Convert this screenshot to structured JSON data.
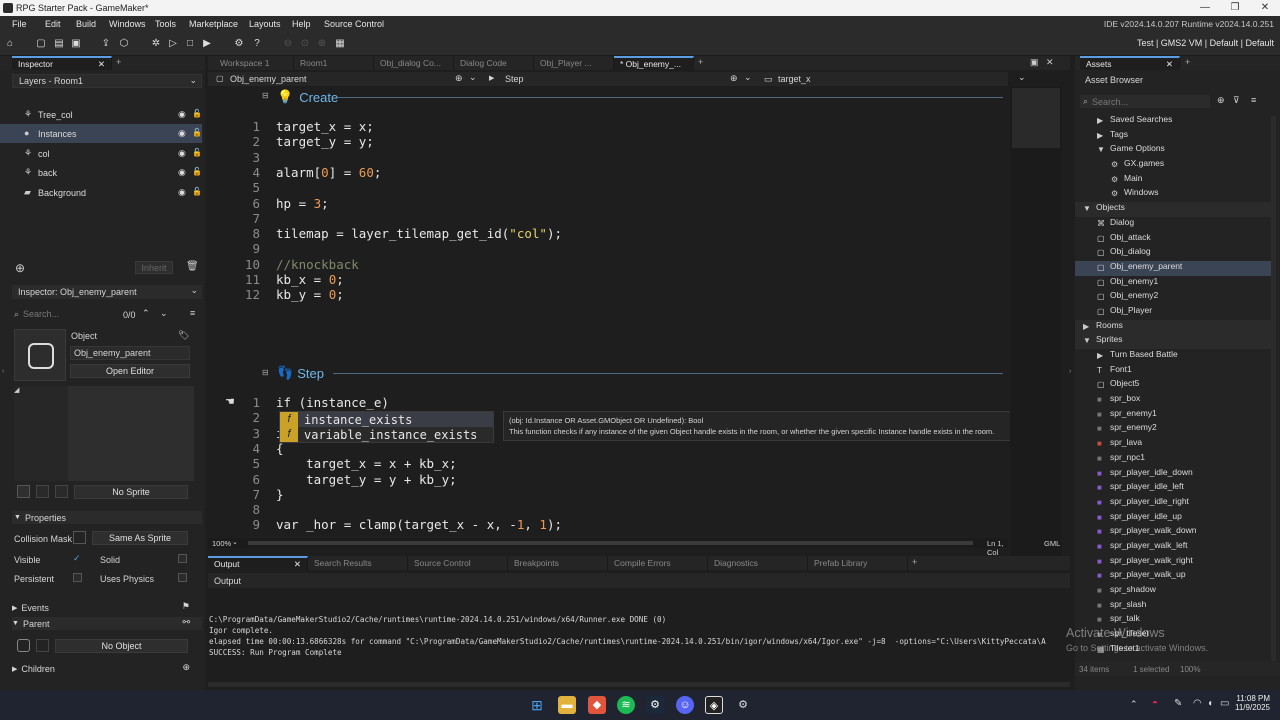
{
  "window": {
    "title": "RPG Starter Pack - GameMaker*"
  },
  "menu": [
    "File",
    "Edit",
    "Build",
    "Windows",
    "Tools",
    "Marketplace",
    "Layouts",
    "Help",
    "Source Control"
  ],
  "ide_version": "IDE v2024.14.0.207  Runtime v2024.14.0.251",
  "target_bar": "Test | GMS2 VM | Default | Default",
  "left": {
    "inspector_tab": "Inspector",
    "layers_title": "Layers - Room1",
    "layers": [
      {
        "name": "Tree_col",
        "icon": "tile-icon"
      },
      {
        "name": "Instances",
        "icon": "instance-icon"
      },
      {
        "name": "col",
        "icon": "tile-icon"
      },
      {
        "name": "back",
        "icon": "tile-icon"
      },
      {
        "name": "Background",
        "icon": "background-icon"
      }
    ],
    "inherit_label": "Inherit",
    "inspector_obj_title": "Inspector: Obj_enemy_parent",
    "search_placeholder": "Search...",
    "search_count": "0/0",
    "object_label": "Object",
    "object_name": "Obj_enemy_parent",
    "open_editor": "Open Editor",
    "no_sprite": "No Sprite",
    "properties_label": "Properties",
    "collision_mask_label": "Collision Mask",
    "same_as_sprite": "Same As Sprite",
    "visible_label": "Visible",
    "solid_label": "Solid",
    "persistent_label": "Persistent",
    "uses_physics_label": "Uses Physics",
    "events_label": "Events",
    "parent_label": "Parent",
    "no_object": "No Object",
    "children_label": "Children"
  },
  "editor": {
    "tabs": [
      "Workspace 1",
      "Room1",
      "Obj_dialog Co...",
      "Dialog Code",
      "Obj_Player ...",
      "* Obj_enemy_..."
    ],
    "breadcrumb_object": "Obj_enemy_parent",
    "breadcrumb_event": "Step",
    "breadcrumb_var": "target_x",
    "create_header": "Create",
    "step_header": "Step",
    "zoom": "100%",
    "cursor_pos": "Ln 1, Col 15",
    "lang": "GML",
    "create_lines": [
      {
        "n": "1",
        "t": "target_x = x;"
      },
      {
        "n": "2",
        "t": "target_y = y;"
      },
      {
        "n": "3",
        "t": ""
      },
      {
        "n": "4",
        "t": "alarm[0] = 60;"
      },
      {
        "n": "5",
        "t": ""
      },
      {
        "n": "6",
        "t": "hp = 3;"
      },
      {
        "n": "7",
        "t": ""
      },
      {
        "n": "8",
        "t": "tilemap = layer_tilemap_get_id(\"col\");"
      },
      {
        "n": "9",
        "t": ""
      },
      {
        "n": "10",
        "t": "//knockback"
      },
      {
        "n": "11",
        "t": "kb_x = 0;"
      },
      {
        "n": "12",
        "t": "kb_y = 0;"
      }
    ],
    "step_lines": [
      {
        "n": "1",
        "t": "if (instance_e)"
      },
      {
        "n": "2",
        "t": ""
      },
      {
        "n": "3",
        "t": "i"
      },
      {
        "n": "4",
        "t": "{"
      },
      {
        "n": "5",
        "t": "    target_x = x + kb_x;"
      },
      {
        "n": "6",
        "t": "    target_y = y + kb_y;"
      },
      {
        "n": "7",
        "t": "}"
      },
      {
        "n": "8",
        "t": ""
      },
      {
        "n": "9",
        "t": "var _hor = clamp(target_x - x, -1, 1);"
      }
    ],
    "autocomplete": [
      "instance_exists",
      "variable_instance_exists"
    ],
    "tooltip_sig": "(obj: Id.Instance OR Asset.GMObject OR Undefined): Bool",
    "tooltip_desc": "This function checks if any instance of the given Object handle exists in the room, or whether the given specific Instance handle exists in the room."
  },
  "output": {
    "tabs": [
      "Output",
      "Search Results",
      "Source Control",
      "Breakpoints",
      "Compile Errors",
      "Diagnostics",
      "Prefab Library"
    ],
    "header": "Output",
    "lines": [
      "C:\\ProgramData/GameMakerStudio2/Cache/runtimes\\runtime-2024.14.0.251/windows/x64/Runner.exe DONE (0)",
      "Igor complete.",
      "elapsed time 00:00:13.6866328s for command \"C:\\ProgramData/GameMakerStudio2/Cache/runtimes\\runtime-2024.14.0.251/bin/igor/windows/x64/Igor.exe\" -j=8  -options=\"C:\\Users\\KittyPeccata\\A",
      "SUCCESS: Run Program Complete"
    ]
  },
  "assets": {
    "tab": "Assets",
    "title": "Asset Browser",
    "search_placeholder": "Search...",
    "items": [
      {
        "label": "Saved Searches",
        "indent": 1,
        "kind": "folder-closed"
      },
      {
        "label": "Tags",
        "indent": 1,
        "kind": "folder-closed"
      },
      {
        "label": "Game Options",
        "indent": 1,
        "kind": "folder-open"
      },
      {
        "label": "GX.games",
        "indent": 2,
        "kind": "gear"
      },
      {
        "label": "Main",
        "indent": 2,
        "kind": "gear"
      },
      {
        "label": "Windows",
        "indent": 2,
        "kind": "gear"
      },
      {
        "label": "Objects",
        "indent": 0,
        "kind": "group"
      },
      {
        "label": "Dialog",
        "indent": 1,
        "kind": "script"
      },
      {
        "label": "Obj_attack",
        "indent": 1,
        "kind": "object"
      },
      {
        "label": "Obj_dialog",
        "indent": 1,
        "kind": "object"
      },
      {
        "label": "Obj_enemy_parent",
        "indent": 1,
        "kind": "object",
        "selected": true
      },
      {
        "label": "Obj_enemy1",
        "indent": 1,
        "kind": "object"
      },
      {
        "label": "Obj_enemy2",
        "indent": 1,
        "kind": "object"
      },
      {
        "label": "Obj_Player",
        "indent": 1,
        "kind": "object"
      },
      {
        "label": "Rooms",
        "indent": 0,
        "kind": "group-closed"
      },
      {
        "label": "Sprites",
        "indent": 0,
        "kind": "group"
      },
      {
        "label": "Turn Based Battle",
        "indent": 1,
        "kind": "folder-closed"
      },
      {
        "label": "Font1",
        "indent": 1,
        "kind": "font"
      },
      {
        "label": "Object5",
        "indent": 1,
        "kind": "object"
      },
      {
        "label": "spr_box",
        "indent": 1,
        "kind": "sprite"
      },
      {
        "label": "spr_enemy1",
        "indent": 1,
        "kind": "sprite"
      },
      {
        "label": "spr_enemy2",
        "indent": 1,
        "kind": "sprite"
      },
      {
        "label": "spr_lava",
        "indent": 1,
        "kind": "sprite-red"
      },
      {
        "label": "spr_npc1",
        "indent": 1,
        "kind": "sprite"
      },
      {
        "label": "spr_player_idle_down",
        "indent": 1,
        "kind": "sprite-purple"
      },
      {
        "label": "spr_player_idle_left",
        "indent": 1,
        "kind": "sprite-purple"
      },
      {
        "label": "spr_player_idle_right",
        "indent": 1,
        "kind": "sprite-purple"
      },
      {
        "label": "spr_player_idle_up",
        "indent": 1,
        "kind": "sprite-purple"
      },
      {
        "label": "spr_player_walk_down",
        "indent": 1,
        "kind": "sprite-purple"
      },
      {
        "label": "spr_player_walk_left",
        "indent": 1,
        "kind": "sprite-purple"
      },
      {
        "label": "spr_player_walk_right",
        "indent": 1,
        "kind": "sprite-purple"
      },
      {
        "label": "spr_player_walk_up",
        "indent": 1,
        "kind": "sprite-purple"
      },
      {
        "label": "spr_shadow",
        "indent": 1,
        "kind": "sprite"
      },
      {
        "label": "spr_slash",
        "indent": 1,
        "kind": "sprite"
      },
      {
        "label": "spr_talk",
        "indent": 1,
        "kind": "sprite"
      },
      {
        "label": "spr_tileset",
        "indent": 1,
        "kind": "sprite"
      },
      {
        "label": "Tileset1",
        "indent": 1,
        "kind": "tileset"
      }
    ],
    "footer_items": "34 items",
    "footer_selected": "1 selected",
    "footer_zoom": "100%"
  },
  "watermark": {
    "line1": "Activate Windows",
    "line2": "Go to Settings to activate Windows."
  },
  "clock": {
    "time": "11:08 PM",
    "date": "11/9/2025"
  },
  "colors": {
    "accent": "#5a9de3",
    "selection": "#3b4455",
    "panel": "#232323",
    "editor_bg": "#1e1e1e"
  }
}
